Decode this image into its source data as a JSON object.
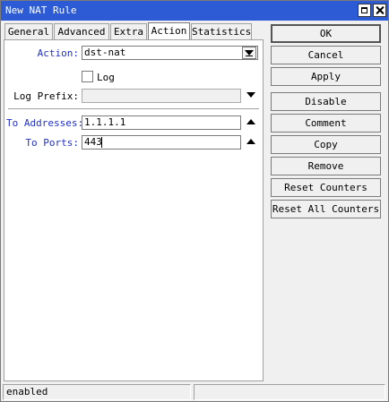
{
  "window": {
    "title": "New NAT Rule"
  },
  "tabs": [
    {
      "label": "General"
    },
    {
      "label": "Advanced"
    },
    {
      "label": "Extra"
    },
    {
      "label": "Action"
    },
    {
      "label": "Statistics"
    }
  ],
  "active_tab": "Action",
  "form": {
    "action": {
      "label": "Action:",
      "value": "dst-nat"
    },
    "log": {
      "label": "Log",
      "checked": false
    },
    "log_prefix": {
      "label": "Log Prefix:",
      "value": ""
    },
    "to_addresses": {
      "label": "To Addresses:",
      "value": "1.1.1.1"
    },
    "to_ports": {
      "label": "To Ports:",
      "value": "443"
    }
  },
  "buttons": {
    "ok": "OK",
    "cancel": "Cancel",
    "apply": "Apply",
    "disable": "Disable",
    "comment": "Comment",
    "copy": "Copy",
    "remove": "Remove",
    "reset_counters": "Reset Counters",
    "reset_all_counters": "Reset All Counters"
  },
  "status": {
    "left": "enabled",
    "right": ""
  },
  "colors": {
    "titlebar": "#2d5bd6",
    "blue_label": "#2030c8"
  }
}
